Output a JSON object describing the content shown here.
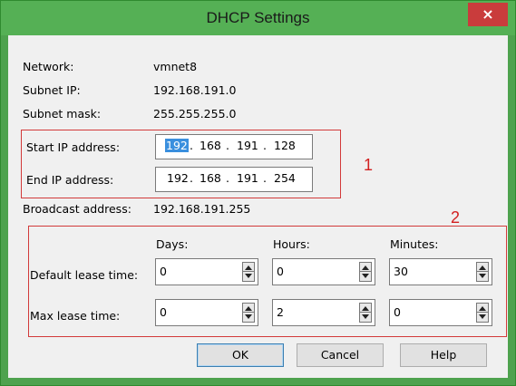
{
  "window": {
    "title": "DHCP Settings",
    "close_glyph": "×"
  },
  "info": {
    "network_label": "Network:",
    "network_value": "vmnet8",
    "subnet_ip_label": "Subnet IP:",
    "subnet_ip_value": "192.168.191.0",
    "subnet_mask_label": "Subnet mask:",
    "subnet_mask_value": "255.255.255.0"
  },
  "ip_range": {
    "start_label": "Start IP address:",
    "start_octets": [
      "192",
      "168",
      "191",
      "128"
    ],
    "end_label": "End IP address:",
    "end_octets": [
      "192",
      "168",
      "191",
      "254"
    ],
    "separator": "."
  },
  "broadcast": {
    "label": "Broadcast address:",
    "value": "192.168.191.255"
  },
  "lease": {
    "col_days": "Days:",
    "col_hours": "Hours:",
    "col_minutes": "Minutes:",
    "default_label": "Default lease time:",
    "default_days": "0",
    "default_hours": "0",
    "default_minutes": "30",
    "max_label": "Max lease time:",
    "max_days": "0",
    "max_hours": "2",
    "max_minutes": "0"
  },
  "annotations": {
    "box1": "1",
    "box2": "2",
    "color": "#d23a3a"
  },
  "buttons": {
    "ok": "OK",
    "cancel": "Cancel",
    "help": "Help"
  }
}
